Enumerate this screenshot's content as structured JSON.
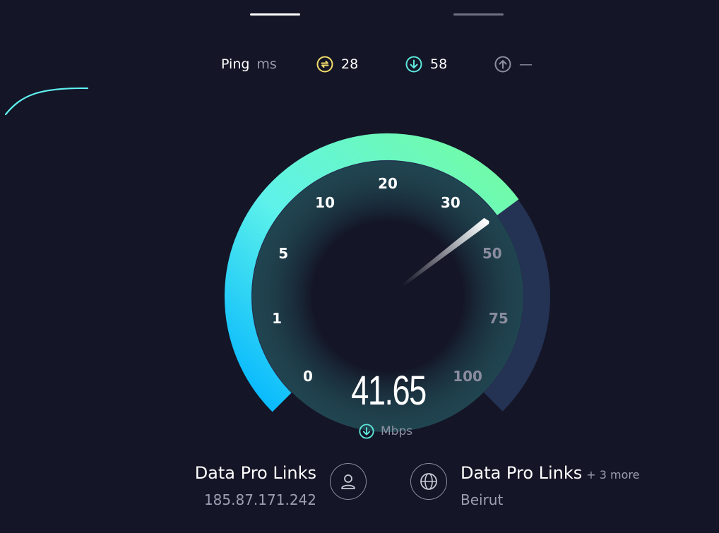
{
  "tabs": [
    {
      "name": "tab-1",
      "active": true
    },
    {
      "name": "tab-2",
      "active": false
    }
  ],
  "metrics": {
    "ping_label": "Ping",
    "ping_unit": "ms",
    "ping_value": "28",
    "download_value": "58",
    "upload_value": "—"
  },
  "gauge": {
    "ticks": [
      "0",
      "1",
      "5",
      "10",
      "20",
      "30",
      "50",
      "75",
      "100"
    ],
    "value_mbps": 41.65,
    "colors": {
      "start": "#00b8ff",
      "mid": "#5ef0e0",
      "end": "#6dfca3",
      "track": "#243253"
    }
  },
  "speed": {
    "value": "41.65",
    "unit": "Mbps"
  },
  "isp": {
    "name": "Data Pro Links",
    "ip": "185.87.171.242"
  },
  "server": {
    "name": "Data Pro Links",
    "more": "+ 3 more",
    "location": "Beirut"
  },
  "icons": [
    "ping-icon",
    "download-icon",
    "upload-icon",
    "user-icon",
    "globe-icon"
  ]
}
